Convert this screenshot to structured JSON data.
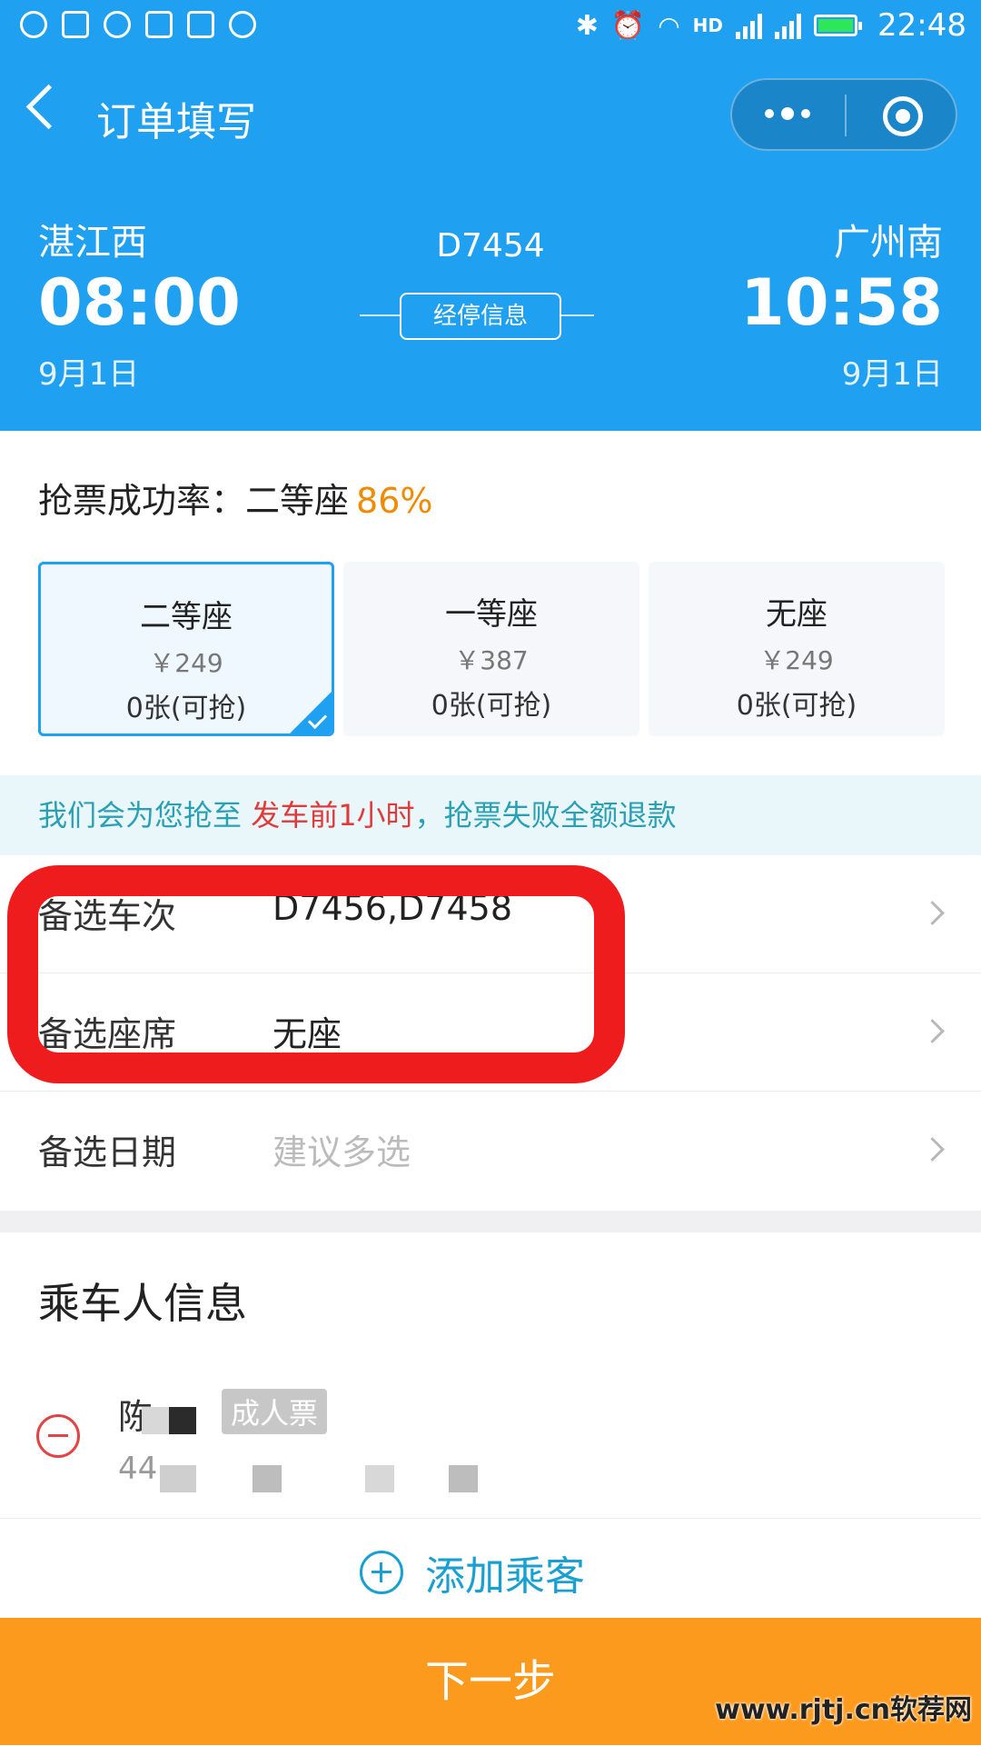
{
  "status_bar": {
    "time": "22:48",
    "network": "HD"
  },
  "nav": {
    "title": "订单填写"
  },
  "trip": {
    "from_station": "湛江西",
    "to_station": "广州南",
    "depart_time": "08:00",
    "arrive_time": "10:58",
    "depart_date": "9月1日",
    "arrive_date": "9月1日",
    "train_number": "D7454",
    "stops_button": "经停信息"
  },
  "success_rate": {
    "label": "抢票成功率：二等座",
    "value": "86%"
  },
  "seats": [
    {
      "name": "二等座",
      "price": "￥249",
      "count": "0张(可抢)"
    },
    {
      "name": "一等座",
      "price": "￥387",
      "count": "0张(可抢)"
    },
    {
      "name": "无座",
      "price": "￥249",
      "count": "0张(可抢)"
    }
  ],
  "notice": {
    "prefix": "我们会为您抢至",
    "highlight": "发车前1小时",
    "suffix": "，抢票失败全额退款"
  },
  "options": [
    {
      "label": "备选车次",
      "value": "D7456,D7458"
    },
    {
      "label": "备选座席",
      "value": "无座"
    },
    {
      "label": "备选日期",
      "placeholder": "建议多选"
    }
  ],
  "passenger": {
    "section_title": "乘车人信息",
    "name": "陈",
    "ticket_type": "成人票",
    "id_prefix": "44"
  },
  "add_passenger": "添加乘客",
  "next_button": "下一步",
  "watermark": "www.rjtj.cn软荐网",
  "colors": {
    "primary": "#1fa0f0",
    "accent": "#fb9a1c",
    "rate": "#f08a00",
    "highlight": "#e03a3a",
    "annotation": "#ee1c1c"
  }
}
